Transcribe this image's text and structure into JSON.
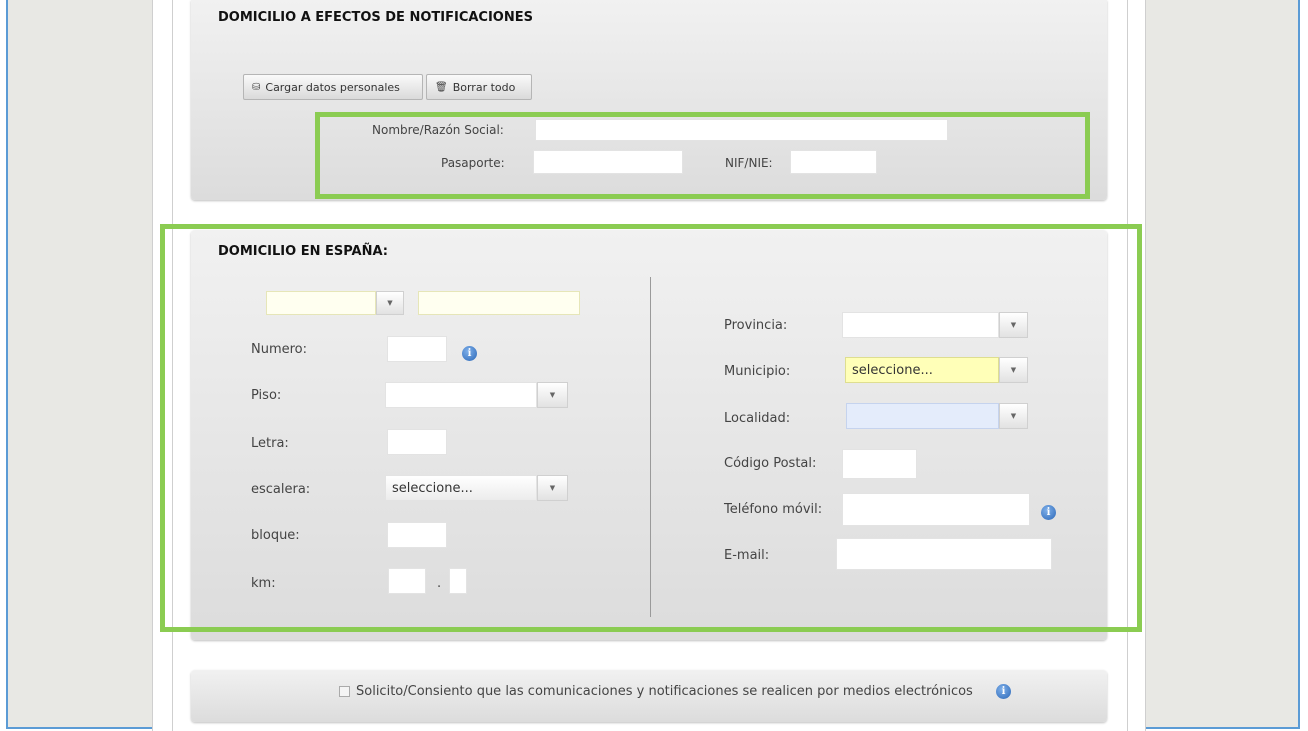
{
  "notif_section": {
    "title": "DOMICILIO A EFECTOS DE NOTIFICACIONES",
    "load_button": "Cargar datos personales",
    "clear_button": "Borrar todo",
    "name_label": "Nombre/Razón Social:",
    "passport_label": "Pasaporte:",
    "nif_label": "NIF/NIE:"
  },
  "spain_section": {
    "title": "DOMICILIO EN ESPAÑA:",
    "numero_label": "Numero:",
    "piso_label": "Piso:",
    "letra_label": "Letra:",
    "escalera_label": "escalera:",
    "escalera_value": "seleccione...",
    "bloque_label": "bloque:",
    "km_label": "km:",
    "km_sep": ".",
    "provincia_label": "Provincia:",
    "municipio_label": "Municipio:",
    "municipio_value": "seleccione...",
    "localidad_label": "Localidad:",
    "cp_label": "Código Postal:",
    "telefono_label": "Teléfono móvil:",
    "email_label": "E-mail:"
  },
  "consent": {
    "text": "Solicito/Consiento que las comunicaciones y notificaciones se realicen por medios electrónicos"
  },
  "icons": {
    "info_glyph": "i",
    "dropdown_glyph": "▼",
    "load_glyph": "⛁",
    "clear_glyph": "🗑"
  },
  "colors": {
    "highlight": "#8bcc52",
    "frame": "#5b9bd5",
    "info": "#2b67b7"
  }
}
